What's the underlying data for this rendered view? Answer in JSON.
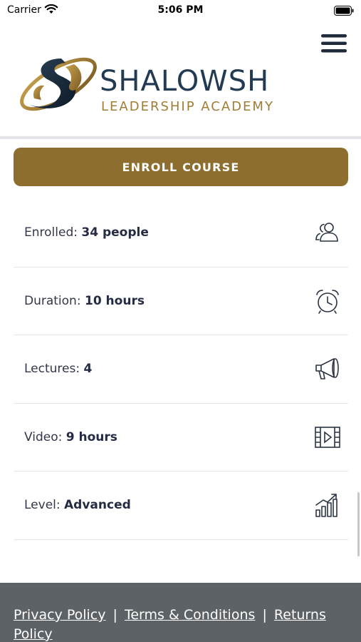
{
  "status_bar": {
    "carrier": "Carrier",
    "time": "5:06 PM"
  },
  "header": {
    "logo_title": "SHALOWSH",
    "logo_subtitle": "LEADERSHIP ACADEMY",
    "menu_icon": "hamburger-menu-icon"
  },
  "enroll": {
    "label": "ENROLL COURSE"
  },
  "info": [
    {
      "label": "Enrolled:",
      "value": "34 people",
      "icon": "people-icon"
    },
    {
      "label": "Duration:",
      "value": "10 hours",
      "icon": "alarm-clock-icon"
    },
    {
      "label": "Lectures:",
      "value": "4",
      "icon": "megaphone-icon"
    },
    {
      "label": "Video:",
      "value": "9 hours",
      "icon": "video-film-icon"
    },
    {
      "label": "Level:",
      "value": "Advanced",
      "icon": "bar-chart-growth-icon"
    }
  ],
  "footer": {
    "privacy": "Privacy Policy",
    "separator": "|",
    "terms": "Terms & Conditions",
    "returns": "Returns Policy"
  },
  "colors": {
    "brand_gold": "#8d6e2f",
    "brand_navy": "#233b52",
    "footer_bg": "#5d6266"
  }
}
